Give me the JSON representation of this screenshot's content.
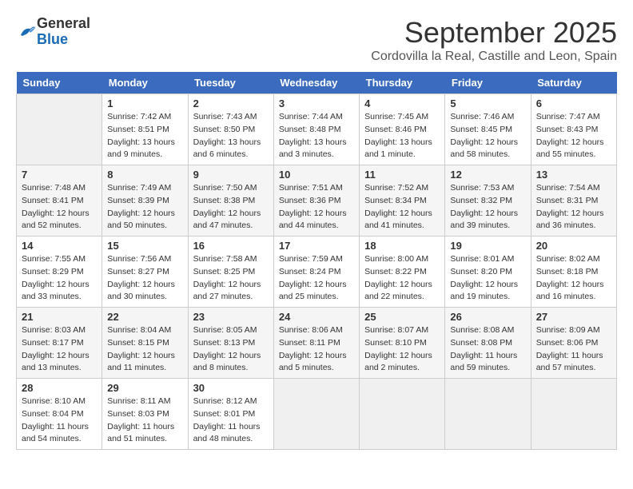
{
  "header": {
    "logo_line1": "General",
    "logo_line2": "Blue",
    "month": "September 2025",
    "location": "Cordovilla la Real, Castille and Leon, Spain"
  },
  "weekdays": [
    "Sunday",
    "Monday",
    "Tuesday",
    "Wednesday",
    "Thursday",
    "Friday",
    "Saturday"
  ],
  "weeks": [
    [
      {
        "day": "",
        "info": ""
      },
      {
        "day": "1",
        "info": "Sunrise: 7:42 AM\nSunset: 8:51 PM\nDaylight: 13 hours\nand 9 minutes."
      },
      {
        "day": "2",
        "info": "Sunrise: 7:43 AM\nSunset: 8:50 PM\nDaylight: 13 hours\nand 6 minutes."
      },
      {
        "day": "3",
        "info": "Sunrise: 7:44 AM\nSunset: 8:48 PM\nDaylight: 13 hours\nand 3 minutes."
      },
      {
        "day": "4",
        "info": "Sunrise: 7:45 AM\nSunset: 8:46 PM\nDaylight: 13 hours\nand 1 minute."
      },
      {
        "day": "5",
        "info": "Sunrise: 7:46 AM\nSunset: 8:45 PM\nDaylight: 12 hours\nand 58 minutes."
      },
      {
        "day": "6",
        "info": "Sunrise: 7:47 AM\nSunset: 8:43 PM\nDaylight: 12 hours\nand 55 minutes."
      }
    ],
    [
      {
        "day": "7",
        "info": "Sunrise: 7:48 AM\nSunset: 8:41 PM\nDaylight: 12 hours\nand 52 minutes."
      },
      {
        "day": "8",
        "info": "Sunrise: 7:49 AM\nSunset: 8:39 PM\nDaylight: 12 hours\nand 50 minutes."
      },
      {
        "day": "9",
        "info": "Sunrise: 7:50 AM\nSunset: 8:38 PM\nDaylight: 12 hours\nand 47 minutes."
      },
      {
        "day": "10",
        "info": "Sunrise: 7:51 AM\nSunset: 8:36 PM\nDaylight: 12 hours\nand 44 minutes."
      },
      {
        "day": "11",
        "info": "Sunrise: 7:52 AM\nSunset: 8:34 PM\nDaylight: 12 hours\nand 41 minutes."
      },
      {
        "day": "12",
        "info": "Sunrise: 7:53 AM\nSunset: 8:32 PM\nDaylight: 12 hours\nand 39 minutes."
      },
      {
        "day": "13",
        "info": "Sunrise: 7:54 AM\nSunset: 8:31 PM\nDaylight: 12 hours\nand 36 minutes."
      }
    ],
    [
      {
        "day": "14",
        "info": "Sunrise: 7:55 AM\nSunset: 8:29 PM\nDaylight: 12 hours\nand 33 minutes."
      },
      {
        "day": "15",
        "info": "Sunrise: 7:56 AM\nSunset: 8:27 PM\nDaylight: 12 hours\nand 30 minutes."
      },
      {
        "day": "16",
        "info": "Sunrise: 7:58 AM\nSunset: 8:25 PM\nDaylight: 12 hours\nand 27 minutes."
      },
      {
        "day": "17",
        "info": "Sunrise: 7:59 AM\nSunset: 8:24 PM\nDaylight: 12 hours\nand 25 minutes."
      },
      {
        "day": "18",
        "info": "Sunrise: 8:00 AM\nSunset: 8:22 PM\nDaylight: 12 hours\nand 22 minutes."
      },
      {
        "day": "19",
        "info": "Sunrise: 8:01 AM\nSunset: 8:20 PM\nDaylight: 12 hours\nand 19 minutes."
      },
      {
        "day": "20",
        "info": "Sunrise: 8:02 AM\nSunset: 8:18 PM\nDaylight: 12 hours\nand 16 minutes."
      }
    ],
    [
      {
        "day": "21",
        "info": "Sunrise: 8:03 AM\nSunset: 8:17 PM\nDaylight: 12 hours\nand 13 minutes."
      },
      {
        "day": "22",
        "info": "Sunrise: 8:04 AM\nSunset: 8:15 PM\nDaylight: 12 hours\nand 11 minutes."
      },
      {
        "day": "23",
        "info": "Sunrise: 8:05 AM\nSunset: 8:13 PM\nDaylight: 12 hours\nand 8 minutes."
      },
      {
        "day": "24",
        "info": "Sunrise: 8:06 AM\nSunset: 8:11 PM\nDaylight: 12 hours\nand 5 minutes."
      },
      {
        "day": "25",
        "info": "Sunrise: 8:07 AM\nSunset: 8:10 PM\nDaylight: 12 hours\nand 2 minutes."
      },
      {
        "day": "26",
        "info": "Sunrise: 8:08 AM\nSunset: 8:08 PM\nDaylight: 11 hours\nand 59 minutes."
      },
      {
        "day": "27",
        "info": "Sunrise: 8:09 AM\nSunset: 8:06 PM\nDaylight: 11 hours\nand 57 minutes."
      }
    ],
    [
      {
        "day": "28",
        "info": "Sunrise: 8:10 AM\nSunset: 8:04 PM\nDaylight: 11 hours\nand 54 minutes."
      },
      {
        "day": "29",
        "info": "Sunrise: 8:11 AM\nSunset: 8:03 PM\nDaylight: 11 hours\nand 51 minutes."
      },
      {
        "day": "30",
        "info": "Sunrise: 8:12 AM\nSunset: 8:01 PM\nDaylight: 11 hours\nand 48 minutes."
      },
      {
        "day": "",
        "info": ""
      },
      {
        "day": "",
        "info": ""
      },
      {
        "day": "",
        "info": ""
      },
      {
        "day": "",
        "info": ""
      }
    ]
  ]
}
